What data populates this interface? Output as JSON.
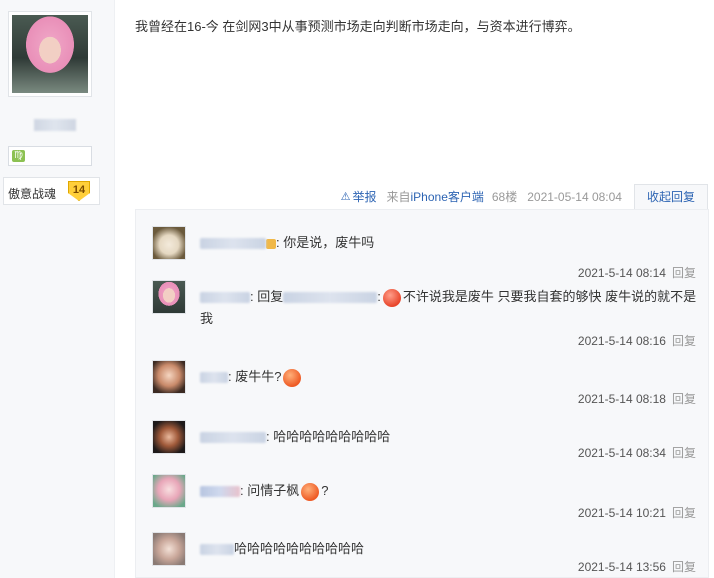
{
  "sidebar": {
    "level_label": "傲意战魂",
    "level_value": "14",
    "zodiac_icon": "virgo-icon"
  },
  "post": {
    "content": "我曾经在16-今 在剑网3中从事预测市场走向判断市场走向，与资本进行博弈。",
    "report_label": "举报",
    "source_prefix": "来自",
    "source_name": "iPhone客户端",
    "floor": "68楼",
    "time": "2021-05-14 08:04",
    "collapse_label": "收起回复"
  },
  "replies": [
    {
      "text": ": 你是说，废牛吗",
      "time": "2021-5-14 08:14",
      "action": "回复"
    },
    {
      "prefix": ": 回复",
      "text": "不许说我是废牛 只要我自套的够快 废牛说的就不是我",
      "time": "2021-5-14 08:16",
      "action": "回复"
    },
    {
      "text": ": 废牛牛?",
      "time": "2021-5-14 08:18",
      "action": "回复"
    },
    {
      "text": ": 哈哈哈哈哈哈哈哈哈",
      "time": "2021-5-14 08:34",
      "action": "回复"
    },
    {
      "text": ": 问情子枫",
      "suffix": "?",
      "time": "2021-5-14 10:21",
      "action": "回复"
    },
    {
      "text": "哈哈哈哈哈哈哈哈哈哈",
      "time": "2021-5-14 13:56",
      "action": "回复"
    }
  ]
}
